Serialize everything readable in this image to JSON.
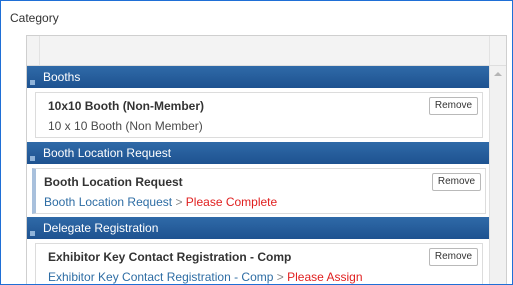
{
  "title": "Category",
  "groups": [
    {
      "label": "Booths",
      "item": {
        "name": "10x10 Booth (Non-Member)",
        "sub": "10 x 10 Booth (Non Member)",
        "remove": "Remove"
      }
    },
    {
      "label": "Booth Location Request",
      "item": {
        "name": "Booth Location Request",
        "sub_link": "Booth Location Request",
        "sub_sep": ">",
        "sub_status": "Please Complete",
        "remove": "Remove"
      }
    },
    {
      "label": "Delegate Registration",
      "item": {
        "name": "Exhibitor Key Contact Registration - Comp",
        "sub_link": "Exhibitor Key Contact Registration - Comp",
        "sub_sep": ">",
        "sub_status": "Please Assign",
        "remove": "Remove"
      }
    }
  ],
  "colors": {
    "frame_border": "#1f6fd6",
    "group_header": "#1e5290",
    "link": "#2e6da4",
    "status": "#e02020"
  }
}
